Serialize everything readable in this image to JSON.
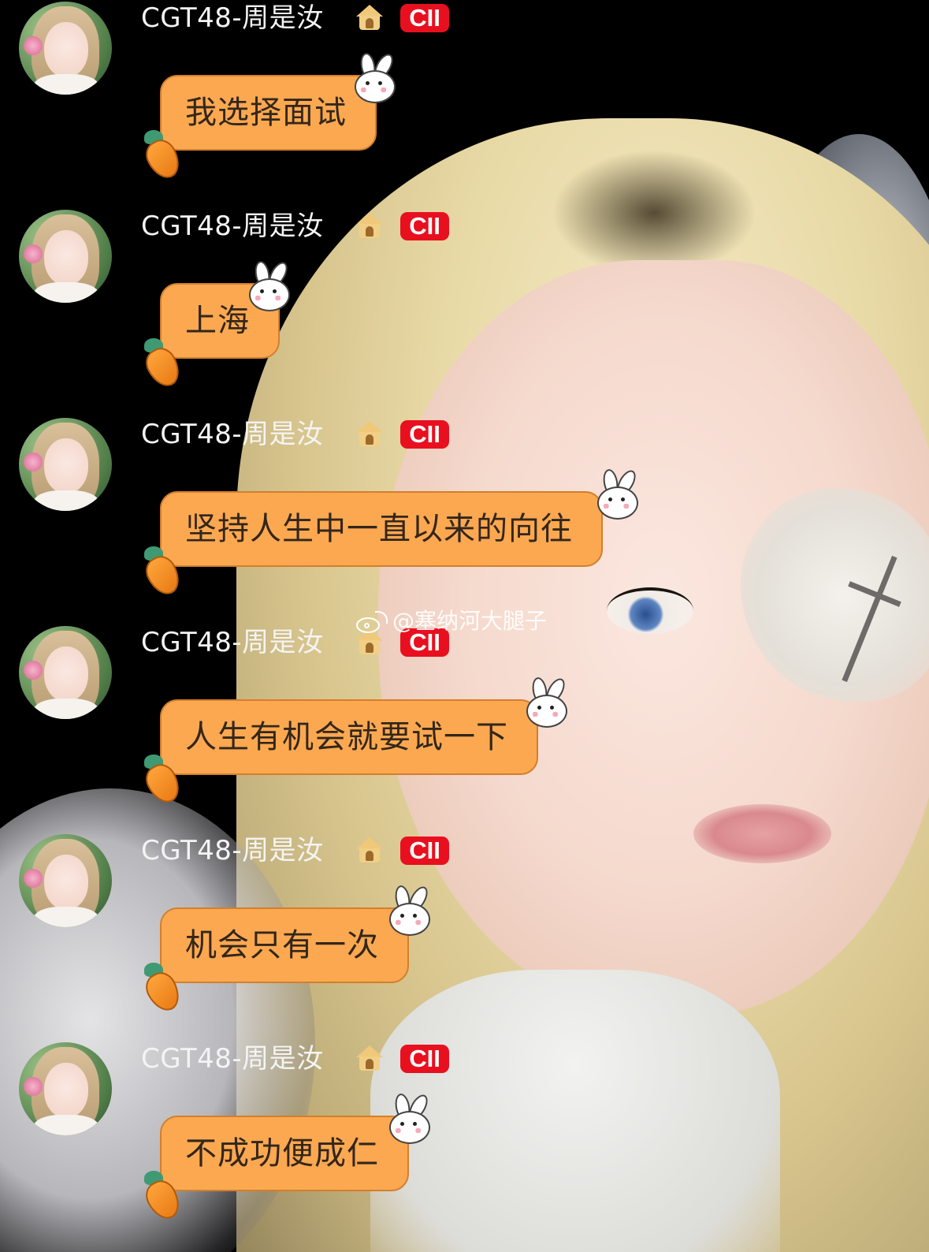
{
  "messages": [
    {
      "sender": "CGT48-周是汝",
      "team": "CII",
      "text": "我选择面试"
    },
    {
      "sender": "CGT48-周是汝",
      "team": "CII",
      "text": "上海"
    },
    {
      "sender": "CGT48-周是汝",
      "team": "CII",
      "text": "坚持人生中一直以来的向往"
    },
    {
      "sender": "CGT48-周是汝",
      "team": "CII",
      "text": "人生有机会就要试一下"
    },
    {
      "sender": "CGT48-周是汝",
      "team": "CII",
      "text": "机会只有一次"
    },
    {
      "sender": "CGT48-周是汝",
      "team": "CII",
      "text": "不成功便成仁"
    }
  ],
  "watermark": "@塞纳河大腿子",
  "icons": {
    "member_badge": "house-icon",
    "bubble_decor_top": "bunny-sticker-icon",
    "bubble_decor_bottom": "carrot-icon",
    "watermark_logo": "weibo-icon"
  },
  "colors": {
    "bubble_fill": "#fba851",
    "bubble_border": "#d27f2d",
    "team_badge": "#e8101f",
    "username_text": "#f4f4f4"
  }
}
